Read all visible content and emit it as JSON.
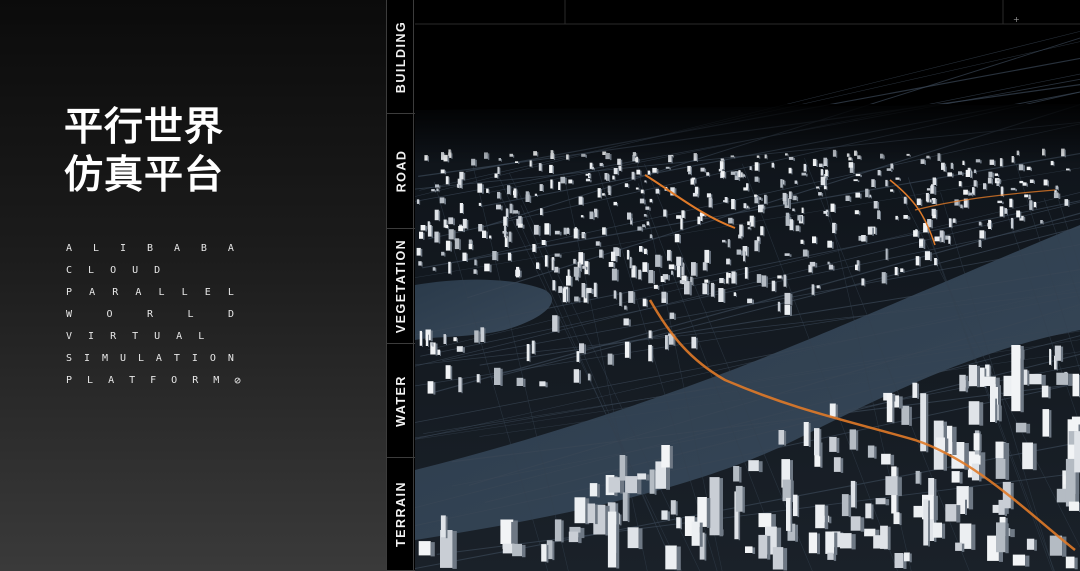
{
  "title": {
    "line1": "平行世界",
    "line2": "仿真平台"
  },
  "subtitle_lines": [
    [
      "A",
      "L",
      "I",
      "B",
      "A",
      "B",
      "A"
    ],
    [
      "C",
      "L",
      "O",
      "U",
      "D"
    ],
    [
      "P",
      "A",
      "R",
      "A",
      "L",
      "L",
      "E",
      "L"
    ],
    [
      "W",
      "O",
      "R",
      "L",
      "D"
    ],
    [
      "V",
      "I",
      "R",
      "T",
      "U",
      "A",
      "L"
    ],
    [
      "S",
      "I",
      "M",
      "U",
      "L",
      "A",
      "T",
      "I",
      "O",
      "N"
    ],
    [
      "P",
      "L",
      "A",
      "T",
      "F",
      "O",
      "R",
      "M"
    ]
  ],
  "end_icon": "empty-set-icon",
  "end_icon_glyph": "⊘",
  "layers": [
    {
      "label": "BUILDING"
    },
    {
      "label": "ROAD"
    },
    {
      "label": "VEGETATION"
    },
    {
      "label": "WATER"
    },
    {
      "label": "TERRAIN"
    }
  ],
  "colors": {
    "road_highlight": "#e07a28",
    "water": "#2c3e50",
    "building": "#d8dde3",
    "ground": "#151c24"
  }
}
